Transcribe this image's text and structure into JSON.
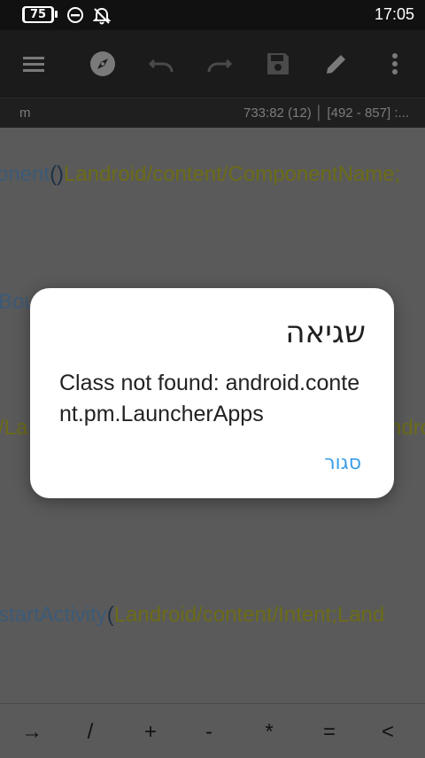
{
  "status_bar": {
    "battery": "75",
    "time": "17:05",
    "icons": [
      "battery-icon",
      "dnd-icon",
      "alarm-off-icon"
    ]
  },
  "toolbar": {
    "icons": [
      "menu-icon",
      "compass-icon",
      "undo-icon",
      "redo-icon",
      "save-icon",
      "edit-icon",
      "more-vert-icon"
    ]
  },
  "info_bar": {
    "left": "m",
    "right": "733:82 (12)  │  [492 - 857] :..."
  },
  "code": {
    "line1_method": "onent",
    "line1_paren": "()",
    "line1_type": "Landroid/content/ComponentName;",
    "line2_method": "Bou",
    "line3_type": "/La",
    "line3_type_right": "ndro",
    "line4_method": "startActivity",
    "line4_paren": "(",
    "line4_type": "Landroid/content/Intent;Land"
  },
  "keyboard_row": [
    "→",
    "/",
    "+",
    "-",
    "*",
    "=",
    "<"
  ],
  "dialog": {
    "title": "שגיאה",
    "message": "Class not found: android.content.pm.LauncherApps",
    "close_button": "סגור"
  },
  "colors": {
    "accent": "#3a9ee8",
    "method": "#3d5a76",
    "type": "#6b6b17"
  }
}
